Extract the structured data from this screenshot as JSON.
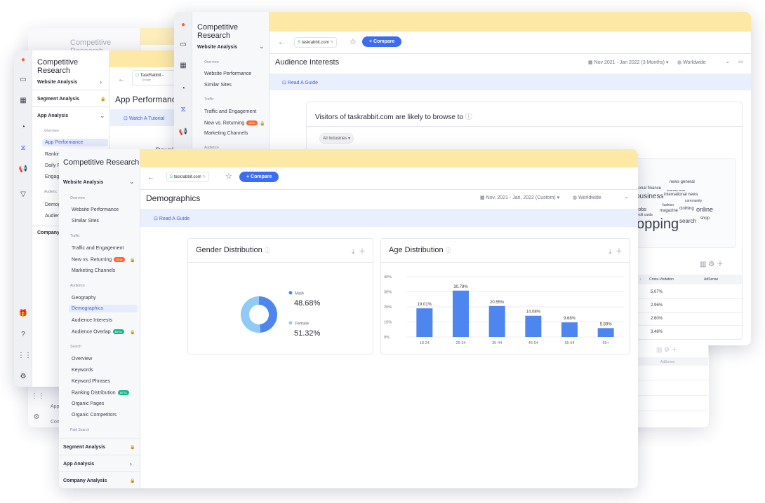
{
  "app": {
    "name": "Competitive Research"
  },
  "back_window": {
    "footer_items": [
      "App",
      "Com"
    ]
  },
  "app_window": {
    "sidebar": {
      "website_analysis": "Website Analysis",
      "segment_analysis": "Segment Analysis",
      "app_analysis": "App Analysis",
      "overview": "Overview",
      "app_performance": "App Performance",
      "ranking": "Rankin",
      "daily": "Daily Ra",
      "engage": "Engage",
      "audience": "Audienc",
      "demog": "Demogr",
      "audien2": "Audienc",
      "company": "Company A"
    },
    "app_chip": {
      "name": "TaskRabbit -",
      "store": "Google"
    },
    "page_title": "App Performance",
    "guide": "Watch A Tutorial",
    "cut_text": "Downl"
  },
  "interests_window": {
    "sidebar": {
      "website_analysis": "Website Analysis",
      "overview": "Overview",
      "website_performance": "Website Performance",
      "similar_sites": "Similar Sites",
      "traffic": "Traffic",
      "traffic_engagement": "Traffic and Engagement",
      "new_vs_returning": "New vs. Returning",
      "marketing_channels": "Marketing Channels",
      "audience": "Audience",
      "new_badge": "NEW"
    },
    "domain": "taskrabbit.com",
    "compare": "+ Compare",
    "page_title": "Audience Interests",
    "date_filter": "Nov 2021 - Jan 2022 (3 Months) ▾",
    "region_filter": "Worldwide",
    "guide": "Read A Guide",
    "card_title": "Visitors of taskrabbit.com are likely to browse to",
    "industries": "All Industries ▾",
    "word_cloud": [
      "news general",
      "personal finance",
      "business news",
      "business",
      "international news",
      "jobs",
      "fashion",
      "community",
      "online",
      "credit cards",
      "magazine",
      "clothing",
      "shopping",
      "search",
      "shop"
    ],
    "table": {
      "headers": [
        "Cross-Visitation",
        "AdSense"
      ],
      "rows": [
        "5.07%",
        "2.96%",
        "2.60%",
        "3.48%"
      ]
    },
    "lower_table_header": "AdSense"
  },
  "demographics_window": {
    "sidebar": {
      "website_analysis": "Website Analysis",
      "overview": "Overview",
      "website_performance": "Website Performance",
      "similar_sites": "Similar Sites",
      "traffic": "Traffic",
      "traffic_engagement": "Traffic and Engagement",
      "new_vs_returning": "New vs. Returning",
      "new_badge": "NEW",
      "marketing_channels": "Marketing Channels",
      "audience": "Audience",
      "geography": "Geography",
      "demographics": "Demographics",
      "audience_interests": "Audience Interests",
      "audience_overlap": "Audience Overlap",
      "beta_badge": "BETA",
      "search": "Search",
      "search_overview": "Overview",
      "keywords": "Keywords",
      "keyword_phrases": "Keyword Phrases",
      "ranking_distribution": "Ranking Distribution",
      "organic_pages": "Organic Pages",
      "organic_competitors": "Organic Competitors",
      "paid_search": "Paid Search",
      "segment_analysis": "Segment Analysis",
      "app_analysis": "App Analysis",
      "company_analysis": "Company Analysis"
    },
    "domain": "taskrabbit.com",
    "compare": "+ Compare",
    "page_title": "Demographics",
    "date_filter": "Nov, 2021 - Jan, 2022 (Custom) ▾",
    "region_filter": "Worldwide",
    "guide": "Read A Guide",
    "gender_card_title": "Gender Distribution",
    "age_card_title": "Age Distribution"
  },
  "colors": {
    "accent": "#3b6cf4",
    "topbar": "#fde9a5",
    "male": "#4e86f0",
    "female": "#8fcaf9",
    "bar": "#4e86f0"
  },
  "chart_data": [
    {
      "type": "pie",
      "title": "Gender Distribution",
      "labels": [
        "Male",
        "Female"
      ],
      "values": [
        48.68,
        51.32
      ],
      "value_labels": [
        "48.68%",
        "51.32%"
      ]
    },
    {
      "type": "bar",
      "title": "Age Distribution",
      "categories": [
        "18-24",
        "25-34",
        "35-44",
        "45-54",
        "55-64",
        "65+"
      ],
      "values": [
        19.01,
        30.79,
        20.55,
        14.08,
        9.68,
        5.89
      ],
      "value_labels": [
        "19.01%",
        "30.79%",
        "20.55%",
        "14.08%",
        "9.68%",
        "5.89%"
      ],
      "yticks": [
        "0%",
        "10%",
        "20%",
        "30%",
        "40%"
      ],
      "ylim": [
        0,
        40
      ],
      "grid": true
    }
  ]
}
